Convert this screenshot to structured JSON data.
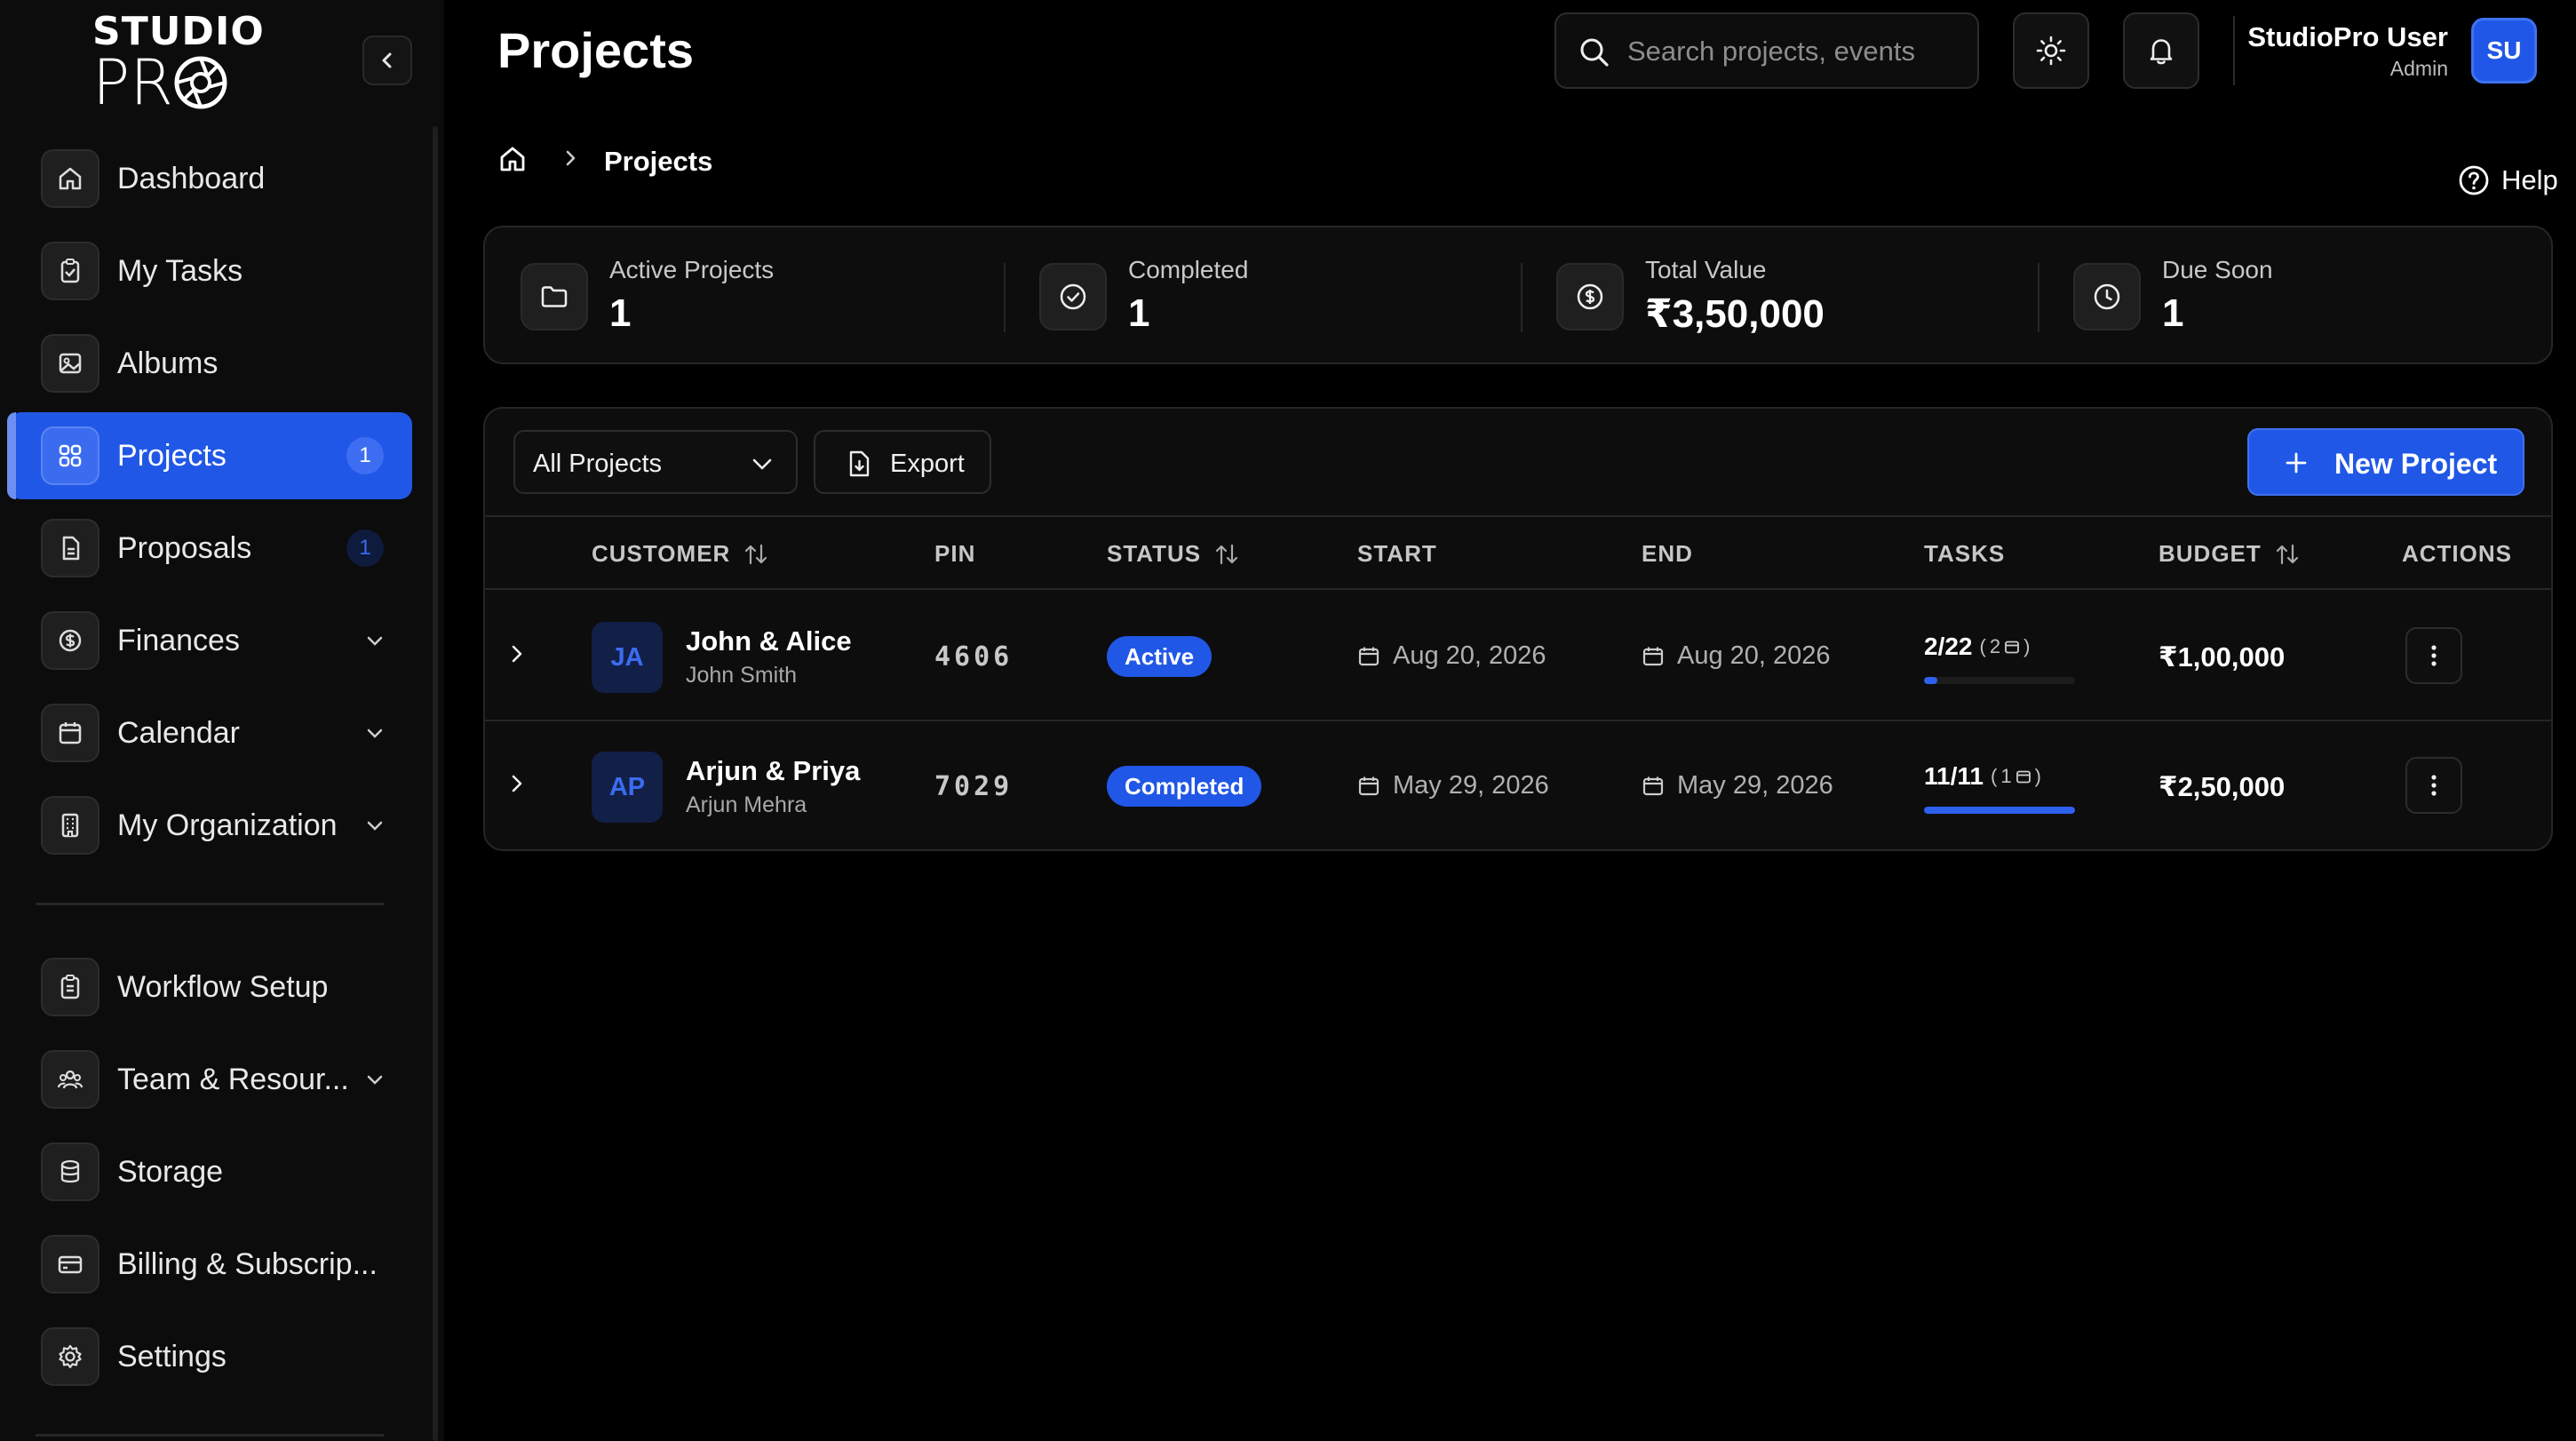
{
  "brand": {
    "line1": "STUDIO",
    "line2": "PR"
  },
  "sidebar": {
    "items": [
      {
        "label": "Dashboard"
      },
      {
        "label": "My Tasks"
      },
      {
        "label": "Albums"
      },
      {
        "label": "Projects",
        "badge": "1"
      },
      {
        "label": "Proposals",
        "badge": "1"
      },
      {
        "label": "Finances"
      },
      {
        "label": "Calendar"
      },
      {
        "label": "My Organization"
      },
      {
        "label": "Workflow Setup"
      },
      {
        "label": "Team & Resour..."
      },
      {
        "label": "Storage"
      },
      {
        "label": "Billing & Subscrip..."
      },
      {
        "label": "Settings"
      }
    ]
  },
  "header": {
    "title": "Projects",
    "search_placeholder": "Search projects, events",
    "user_name": "StudioPro User",
    "user_role": "Admin",
    "user_initials": "SU"
  },
  "breadcrumb": {
    "current": "Projects"
  },
  "help_label": "Help",
  "stats": [
    {
      "label": "Active Projects",
      "value": "1",
      "icon": "folder-icon"
    },
    {
      "label": "Completed",
      "value": "1",
      "icon": "check-circle-icon"
    },
    {
      "label": "Total Value",
      "value": "₹3,50,000",
      "icon": "dollar-circle-icon"
    },
    {
      "label": "Due Soon",
      "value": "1",
      "icon": "clock-icon"
    }
  ],
  "toolbar": {
    "filter_value": "All Projects",
    "export_label": "Export",
    "new_project_label": "New Project"
  },
  "table": {
    "columns": [
      "CUSTOMER",
      "PIN",
      "STATUS",
      "START",
      "END",
      "TASKS",
      "BUDGET",
      "ACTIONS"
    ],
    "rows": [
      {
        "initials": "JA",
        "name": "John & Alice",
        "contact": "John Smith",
        "pin": "4606",
        "status": "Active",
        "start": "Aug 20, 2026",
        "end": "Aug 20, 2026",
        "tasks": "2/22",
        "task_events": "2",
        "progress": 0.09,
        "budget": "₹1,00,000"
      },
      {
        "initials": "AP",
        "name": "Arjun & Priya",
        "contact": "Arjun Mehra",
        "pin": "7029",
        "status": "Completed",
        "start": "May 29, 2026",
        "end": "May 29, 2026",
        "tasks": "11/11",
        "task_events": "1",
        "progress": 1.0,
        "budget": "₹2,50,000"
      }
    ]
  },
  "colors": {
    "accent": "#2057e6",
    "background": "#000000",
    "panel": "#0d0d0d"
  }
}
